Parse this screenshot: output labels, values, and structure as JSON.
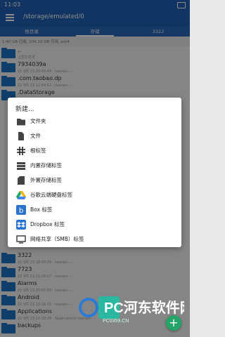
{
  "status": {
    "time": "11:03"
  },
  "appbar": {
    "path": "/storage/emulated/0"
  },
  "tabs": [
    {
      "label": "根目录"
    },
    {
      "label": "存储"
    },
    {
      "label": "3322"
    }
  ],
  "storage_info": "1.40 GB 已用, 104.16 GB 可用, ext4",
  "list": [
    {
      "name": "..",
      "meta": "上层文件夹"
    },
    {
      "name": "7934039a",
      "meta": "21 9月 23 20:09:46 · rwxrwx-- ·"
    },
    {
      "name": ".com.taobao.dp",
      "meta": "22 9月 23 12:54:52 · rwxrwx-- ·"
    },
    {
      "name": ".DataStorage",
      "meta": ""
    },
    {
      "name": "3322",
      "meta": "21 9月 23 18:09:39 · rwxrwx-- ·"
    },
    {
      "name": "7723",
      "meta": "22 9月 23 11:39:17 · rwxrwx-- ·"
    },
    {
      "name": "Alarms",
      "meta": "21 9月 23 20:07:55 · rwxrwx-- ·"
    },
    {
      "name": "Android",
      "meta": "22 9月 23 13:16:11 · rwxrwx-- ·"
    },
    {
      "name": "Applications",
      "meta": "22 9月 23 11:29:28 · Applications rwxrwx-- ·"
    },
    {
      "name": "backups",
      "meta": ""
    }
  ],
  "dialog": {
    "title": "新建...",
    "options": [
      {
        "label": "文件夹",
        "icon": "folder-icon"
      },
      {
        "label": "文件",
        "icon": "file-icon"
      },
      {
        "label": "根标签",
        "icon": "hash-icon"
      },
      {
        "label": "内置存储标签",
        "icon": "internal-storage-icon"
      },
      {
        "label": "外置存储标签",
        "icon": "sd-card-icon"
      },
      {
        "label": "谷歌云端硬盘标签",
        "icon": "google-drive-icon"
      },
      {
        "label": "Box 标签",
        "icon": "box-icon"
      },
      {
        "label": "Dropbox 标签",
        "icon": "dropbox-icon"
      },
      {
        "label": "网络共享（SMB）标签",
        "icon": "network-share-icon"
      }
    ]
  },
  "fab": {
    "label": "+"
  },
  "watermark": {
    "text": "PC河东软件网",
    "subtext": "PC0359.CN"
  },
  "colors": {
    "primary": "#1f5fb3",
    "folder": "#1e71c4",
    "fab": "#24a468"
  }
}
